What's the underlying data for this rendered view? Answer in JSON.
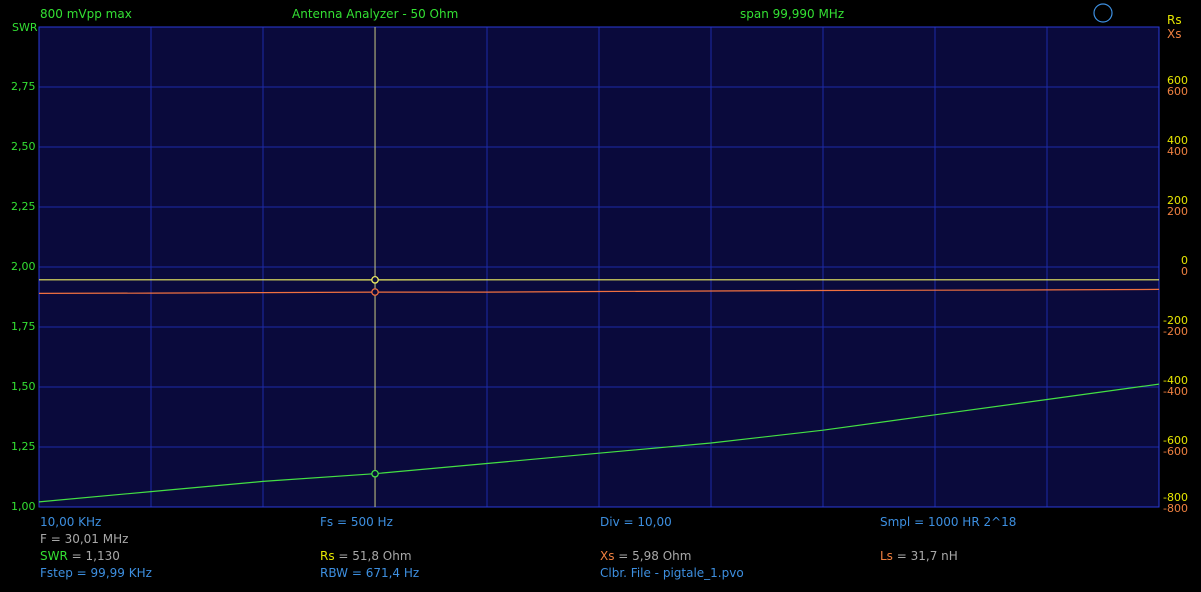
{
  "header": {
    "left": "800 mVpp max",
    "center": "Antenna Analyzer - 50 Ohm",
    "span": "span 99,990 MHz"
  },
  "axes": {
    "left_title": "SWR",
    "right_title_rs": "Rs",
    "right_title_xs": "Xs",
    "swr_ticks": [
      "2,75",
      "2,50",
      "2,25",
      "2,00",
      "1,75",
      "1,50",
      "1,25",
      "1,00"
    ],
    "rs_ticks": [
      "600",
      "400",
      "200",
      "0",
      "-200",
      "-400",
      "-600",
      "-800"
    ],
    "xs_ticks": [
      "600",
      "400",
      "200",
      "0",
      "-200",
      "-400",
      "-600",
      "-800"
    ]
  },
  "footer": {
    "row1": {
      "start_freq": "10,00 KHz",
      "fs": "Fs = 500 Hz",
      "div": "Div = 10,00",
      "smpl": "Smpl = 1000 HR  2^18"
    },
    "row2": {
      "cursor_freq": "F = 30,01 MHz"
    },
    "row3": {
      "swr_label": "SWR",
      "swr_value": " = 1,130",
      "rs_label": "Rs",
      "rs_value": " = 51,8 Ohm",
      "xs_label": "Xs",
      "xs_value": " = 5,98 Ohm",
      "ls_label": "Ls",
      "ls_value": " = 31,7 nH"
    },
    "row4": {
      "fstep": "Fstep = 99,99 KHz",
      "rbw": "RBW = 671,4 Hz",
      "clbr": "Clbr. File - pigtale_1.pvo"
    }
  },
  "colors": {
    "background": "#000000",
    "plot_bg": "#0a0a3c",
    "grid": "#1c2aa8",
    "frame": "#2a3ad8",
    "swr_trace": "#44e044",
    "rs_trace": "#ecec60",
    "xs_trace": "#f07040",
    "cursor": "#c8c880"
  },
  "chart_data": {
    "type": "line",
    "x_unit": "MHz",
    "xlim": [
      0.01,
      100.0
    ],
    "cursor_x": 30.01,
    "swr_axis": {
      "ylim": [
        1.0,
        2.875
      ]
    },
    "impedance_axis": {
      "ylim": [
        -800,
        1000
      ]
    },
    "series": [
      {
        "name": "SWR",
        "axis": "swr",
        "x": [
          0.01,
          10,
          20,
          30.01,
          40,
          50,
          60,
          70,
          80,
          90,
          100
        ],
        "values": [
          1.02,
          1.06,
          1.1,
          1.13,
          1.17,
          1.21,
          1.25,
          1.3,
          1.36,
          1.42,
          1.48
        ]
      },
      {
        "name": "Rs",
        "axis": "impedance",
        "x": [
          0.01,
          10,
          20,
          30.01,
          40,
          50,
          60,
          70,
          80,
          90,
          100
        ],
        "values": [
          52,
          52,
          52,
          51.8,
          52,
          52,
          52,
          52,
          52,
          52,
          52
        ]
      },
      {
        "name": "Xs",
        "axis": "impedance",
        "x": [
          0.01,
          10,
          20,
          30.01,
          40,
          50,
          60,
          70,
          80,
          90,
          100
        ],
        "values": [
          1,
          2,
          4,
          5.98,
          6,
          8,
          10,
          12,
          13,
          14,
          16
        ]
      }
    ]
  }
}
